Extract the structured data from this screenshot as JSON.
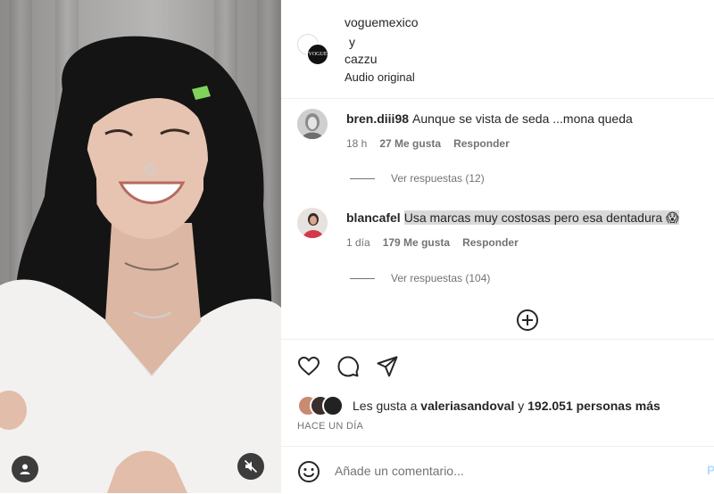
{
  "video": {
    "user_icon": "user-icon",
    "mute_icon": "speaker-muted-icon"
  },
  "header": {
    "author1": "voguemexico",
    "connector": "y",
    "author2": "cazzu",
    "audio": "Audio original",
    "avatar_text": "VOGUE"
  },
  "comments": [
    {
      "user": "bren.diii98",
      "text": "Aunque se vista de seda ...mona queda",
      "time": "18 h",
      "likes": "27 Me gusta",
      "reply": "Responder",
      "view_replies": "Ver respuestas (12)"
    },
    {
      "user": "blancafel",
      "text": "Usa marcas muy costosas pero esa dentadura",
      "emoji": "😱",
      "time": "1 día",
      "likes": "179 Me gusta",
      "reply": "Responder",
      "view_replies": "Ver respuestas (104)"
    }
  ],
  "actions": {
    "icons": [
      "heart-icon",
      "comment-icon",
      "share-icon"
    ],
    "likes_prefix": "Les gusta a",
    "likes_user": "valeriasandoval",
    "likes_middle": "y",
    "likes_count": "192.051 personas más",
    "date": "HACE UN DÍA"
  },
  "add_comment": {
    "placeholder": "Añade un comentario...",
    "publish": "P"
  },
  "colors": {
    "text": "#262626",
    "muted": "#737373",
    "divider": "#efefef",
    "highlight": "#d9d9d9"
  }
}
